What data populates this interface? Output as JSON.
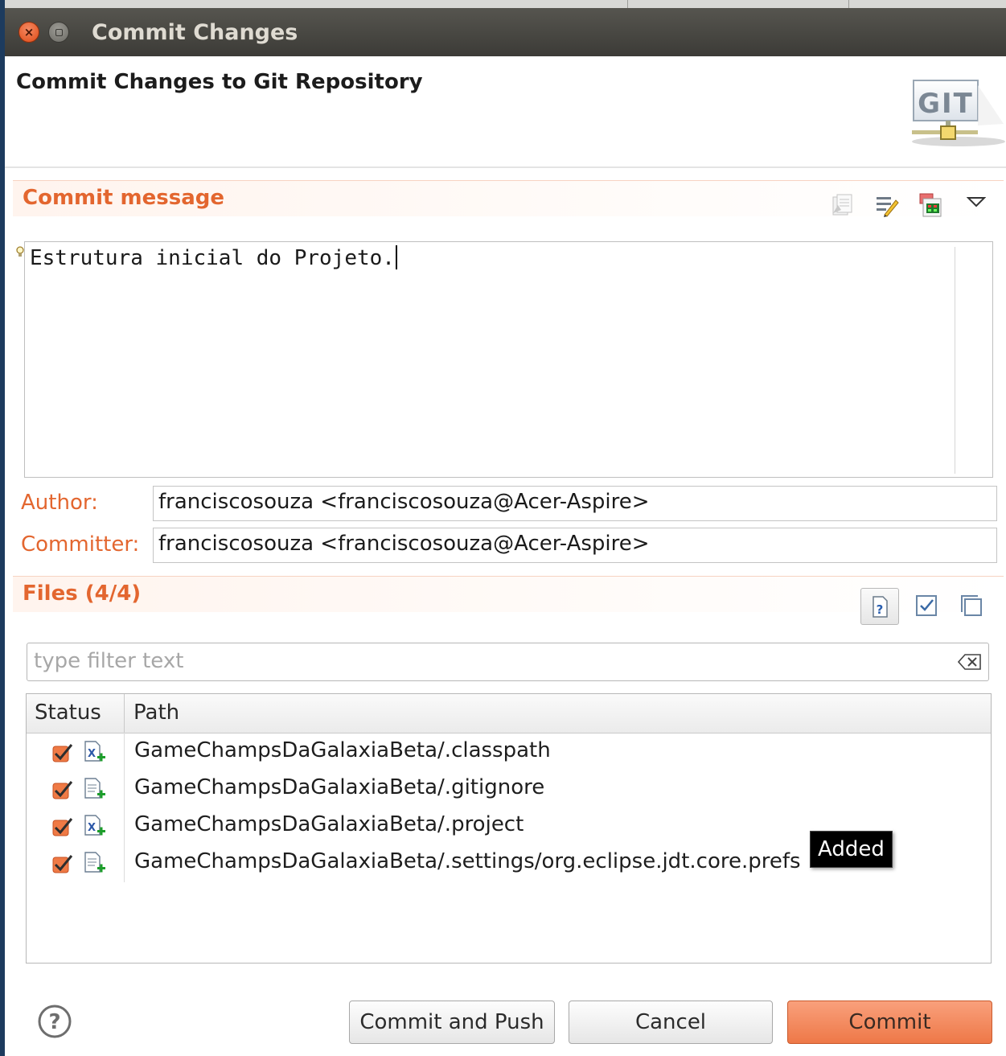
{
  "window": {
    "title": "Commit Changes"
  },
  "header": {
    "title": "Commit Changes to Git Repository",
    "logo_text": "GIT"
  },
  "commit_message": {
    "section_title": "Commit message",
    "text": "Estrutura inicial do Projeto."
  },
  "author": {
    "label": "Author:",
    "value": "franciscosouza <franciscosouza@Acer-Aspire>"
  },
  "committer": {
    "label": "Committer:",
    "value": "franciscosouza <franciscosouza@Acer-Aspire>"
  },
  "files": {
    "section_title": "Files (4/4)",
    "filter_placeholder": "type filter text",
    "columns": {
      "status": "Status",
      "path": "Path"
    },
    "rows": [
      {
        "path": "GameChampsDaGalaxiaBeta/.classpath",
        "icon": "xml-file-added-icon"
      },
      {
        "path": "GameChampsDaGalaxiaBeta/.gitignore",
        "icon": "text-file-added-icon"
      },
      {
        "path": "GameChampsDaGalaxiaBeta/.project",
        "icon": "xml-file-added-icon"
      },
      {
        "path": "GameChampsDaGalaxiaBeta/.settings/org.eclipse.jdt.core.prefs",
        "icon": "text-file-added-icon"
      }
    ]
  },
  "tooltip": {
    "text": "Added"
  },
  "buttons": {
    "commit_and_push": "Commit and Push",
    "cancel": "Cancel",
    "commit": "Commit"
  },
  "colors": {
    "accent": "#e3662f",
    "primary_button": "#f08a5d",
    "titlebar": "#45443f"
  }
}
